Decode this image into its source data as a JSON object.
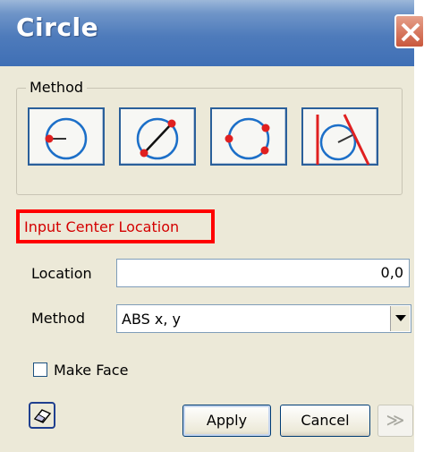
{
  "dialog": {
    "title": "Circle",
    "method_group_label": "Method",
    "method_buttons": [
      {
        "name": "center-radius",
        "icon": "circle-center-radius-icon"
      },
      {
        "name": "diameter",
        "icon": "circle-diameter-icon"
      },
      {
        "name": "three-point",
        "icon": "circle-three-point-icon"
      },
      {
        "name": "tangent",
        "icon": "circle-tangent-icon"
      }
    ],
    "prompt": "Input Center Location",
    "location": {
      "label": "Location",
      "value": "0,0"
    },
    "method_select": {
      "label": "Method",
      "value": "ABS x, y"
    },
    "make_face": {
      "label": "Make Face",
      "checked": false
    },
    "buttons": {
      "apply": "Apply",
      "cancel": "Cancel",
      "more": "≫"
    },
    "colors": {
      "accent": "#1c6fc8",
      "point": "#e02020",
      "prompt": "#d40000"
    }
  }
}
